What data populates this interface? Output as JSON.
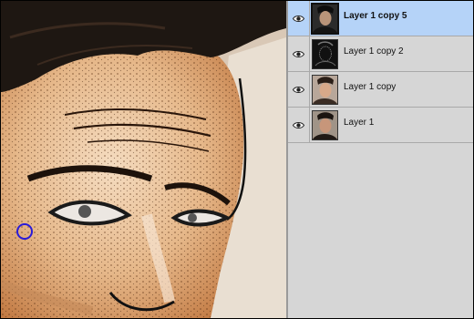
{
  "layers_panel": {
    "layers": [
      {
        "name": "Layer 1 copy 5",
        "selected": true,
        "thumb": "dark-face"
      },
      {
        "name": "Layer 1 copy 2",
        "selected": false,
        "thumb": "outline-face"
      },
      {
        "name": "Layer 1 copy",
        "selected": false,
        "thumb": "color-face"
      },
      {
        "name": "Layer 1",
        "selected": false,
        "thumb": "dark-face"
      }
    ]
  },
  "icons": {
    "visibility": "eye-icon",
    "brush": "brush-cursor-circle"
  },
  "colors": {
    "selection": "#b5d3f8",
    "brush_cursor": "#2a1bd8"
  }
}
